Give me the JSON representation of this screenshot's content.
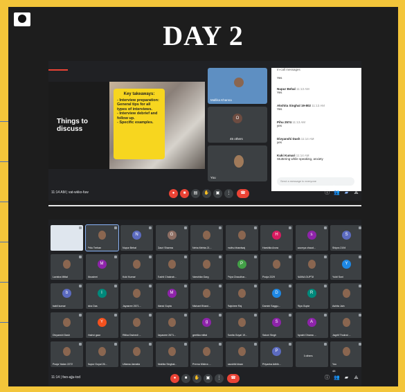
{
  "heading": "DAY 2",
  "meeting1": {
    "slide_text": "Things to discuss",
    "takeaways_title": "Key takeaways:",
    "takeaways": [
      "- Interview preparation: General tips for all types of interviews.",
      "- Interview debrief and follow up.",
      "- Specific examples."
    ],
    "tiles": [
      "Mallika Khanna",
      "45 others",
      "You"
    ],
    "chat_header": "In-call messages",
    "chat": [
      {
        "who": "",
        "time": "",
        "text": "Yes"
      },
      {
        "who": "Nupur Behal",
        "time": "11:13 AM",
        "text": "Yes"
      },
      {
        "who": "Akshita Singhal 19-802",
        "time": "11:13 AM",
        "text": "Yes"
      },
      {
        "who": "Pihu 2574",
        "time": "11:13 AM",
        "text": "yes"
      },
      {
        "who": "Divyanshi Dash",
        "time": "11:14 AM",
        "text": "yes"
      },
      {
        "who": "Kuki Kumari",
        "time": "11:14 AM",
        "text": "Stuttering while speaking, anxiety"
      }
    ],
    "chat_placeholder": "Send a message to everyone",
    "bar_info": "11:14 AM  |  vat-wkkx-fuw",
    "participants_count": "46"
  },
  "meeting2": {
    "bar_info": "11:14  |  fwo-ajju-tod",
    "participants_count": "48",
    "grid": [
      {
        "name": "",
        "letter": "",
        "color": "#3c4043"
      },
      {
        "name": "Pritu Trehan",
        "letter": "",
        "color": "#3c4043"
      },
      {
        "name": "Nupur Behal",
        "letter": "N",
        "color": "#5c6bc0"
      },
      {
        "name": "Gauri Sharma",
        "letter": "G",
        "color": "#8d6e63"
      },
      {
        "name": "Neha Mehta 21...",
        "letter": "",
        "color": "#3c4043"
      },
      {
        "name": "muthu bhardwaj",
        "letter": "",
        "color": "#3c4043"
      },
      {
        "name": "Harshita Arora",
        "letter": "H",
        "color": "#d81b60"
      },
      {
        "name": "soumya chaud...",
        "letter": "s",
        "color": "#8e24aa"
      },
      {
        "name": "Shipra 2194",
        "letter": "S",
        "color": "#5c6bc0"
      },
      {
        "name": "Lavisha Mittal",
        "letter": "",
        "color": "#3c4043"
      },
      {
        "name": "Moushmi",
        "letter": "M",
        "color": "#8e24aa"
      },
      {
        "name": "Kuki Kumari",
        "letter": "",
        "color": "#3c4043"
      },
      {
        "name": "Tushti Chakrab...",
        "letter": "",
        "color": "#3c4043"
      },
      {
        "name": "Vanshika Garg",
        "letter": "",
        "color": "#3c4043"
      },
      {
        "name": "Priya Chaudhar...",
        "letter": "P",
        "color": "#43a047"
      },
      {
        "name": "Pooja 2229",
        "letter": "",
        "color": "#3c4043"
      },
      {
        "name": "NAINA GUPTA",
        "letter": "",
        "color": "#3c4043"
      },
      {
        "name": "Yukti Soni",
        "letter": "Y",
        "color": "#1e88e5"
      },
      {
        "name": "babli kumari",
        "letter": "b",
        "color": "#5c6bc0"
      },
      {
        "name": "Isha Das",
        "letter": "I",
        "color": "#00897b"
      },
      {
        "name": "Jayasree 2671...",
        "letter": "",
        "color": "#3c4043"
      },
      {
        "name": "Mansi Gupta",
        "letter": "M",
        "color": "#8e24aa"
      },
      {
        "name": "Nishant Bhard...",
        "letter": "",
        "color": "#3c4043"
      },
      {
        "name": "Rajshree Raj",
        "letter": "",
        "color": "#3c4043"
      },
      {
        "name": "Damini Saggu...",
        "letter": "D",
        "color": "#1e88e5"
      },
      {
        "name": "Riya Gupta",
        "letter": "R",
        "color": "#00897b"
      },
      {
        "name": "Ashita Jain",
        "letter": "",
        "color": "#3c4043"
      },
      {
        "name": "Divyanshi Dash",
        "letter": "",
        "color": "#3c4043"
      },
      {
        "name": "Yashvi gaur",
        "letter": "Y",
        "color": "#f4511e"
      },
      {
        "name": "Ritika Dwivedi ...",
        "letter": "",
        "color": "#3c4043"
      },
      {
        "name": "Jayasree 2671...",
        "letter": "",
        "color": "#3c4043"
      },
      {
        "name": "geetika mittal",
        "letter": "g",
        "color": "#8e24aa"
      },
      {
        "name": "Sunita Goyal 19...",
        "letter": "",
        "color": "#3c4043"
      },
      {
        "name": "Saloni Singh",
        "letter": "S",
        "color": "#8e24aa"
      },
      {
        "name": "Ayushi Dhama ...",
        "letter": "A",
        "color": "#8e24aa"
      },
      {
        "name": "Jagriti Thukral ...",
        "letter": "",
        "color": "#3c4043"
      },
      {
        "name": "Pooja Yadav 2272",
        "letter": "",
        "color": "#3c4043"
      },
      {
        "name": "Nupur Goyal 26...",
        "letter": "",
        "color": "#3c4043"
      },
      {
        "name": "Uttama Jamatia",
        "letter": "",
        "color": "#3c4043"
      },
      {
        "name": "Akshita Singhal...",
        "letter": "",
        "color": "#3c4043"
      },
      {
        "name": "Prerna Mishra ...",
        "letter": "",
        "color": "#3c4043"
      },
      {
        "name": "kaushiki kisan",
        "letter": "",
        "color": "#3c4043"
      },
      {
        "name": "Priyanka Adhik...",
        "letter": "P",
        "color": "#5c6bc0"
      },
      {
        "name": "6 others",
        "letter": "",
        "color": "#3c4043"
      },
      {
        "name": "You",
        "letter": "",
        "color": "#3c4043"
      }
    ]
  },
  "colors": {
    "frame": "#f3c53a",
    "board": "#1d1d1d",
    "meet_bg": "#202124",
    "accent_red": "#ea4335",
    "takeaway_yellow": "#f7d61f"
  }
}
